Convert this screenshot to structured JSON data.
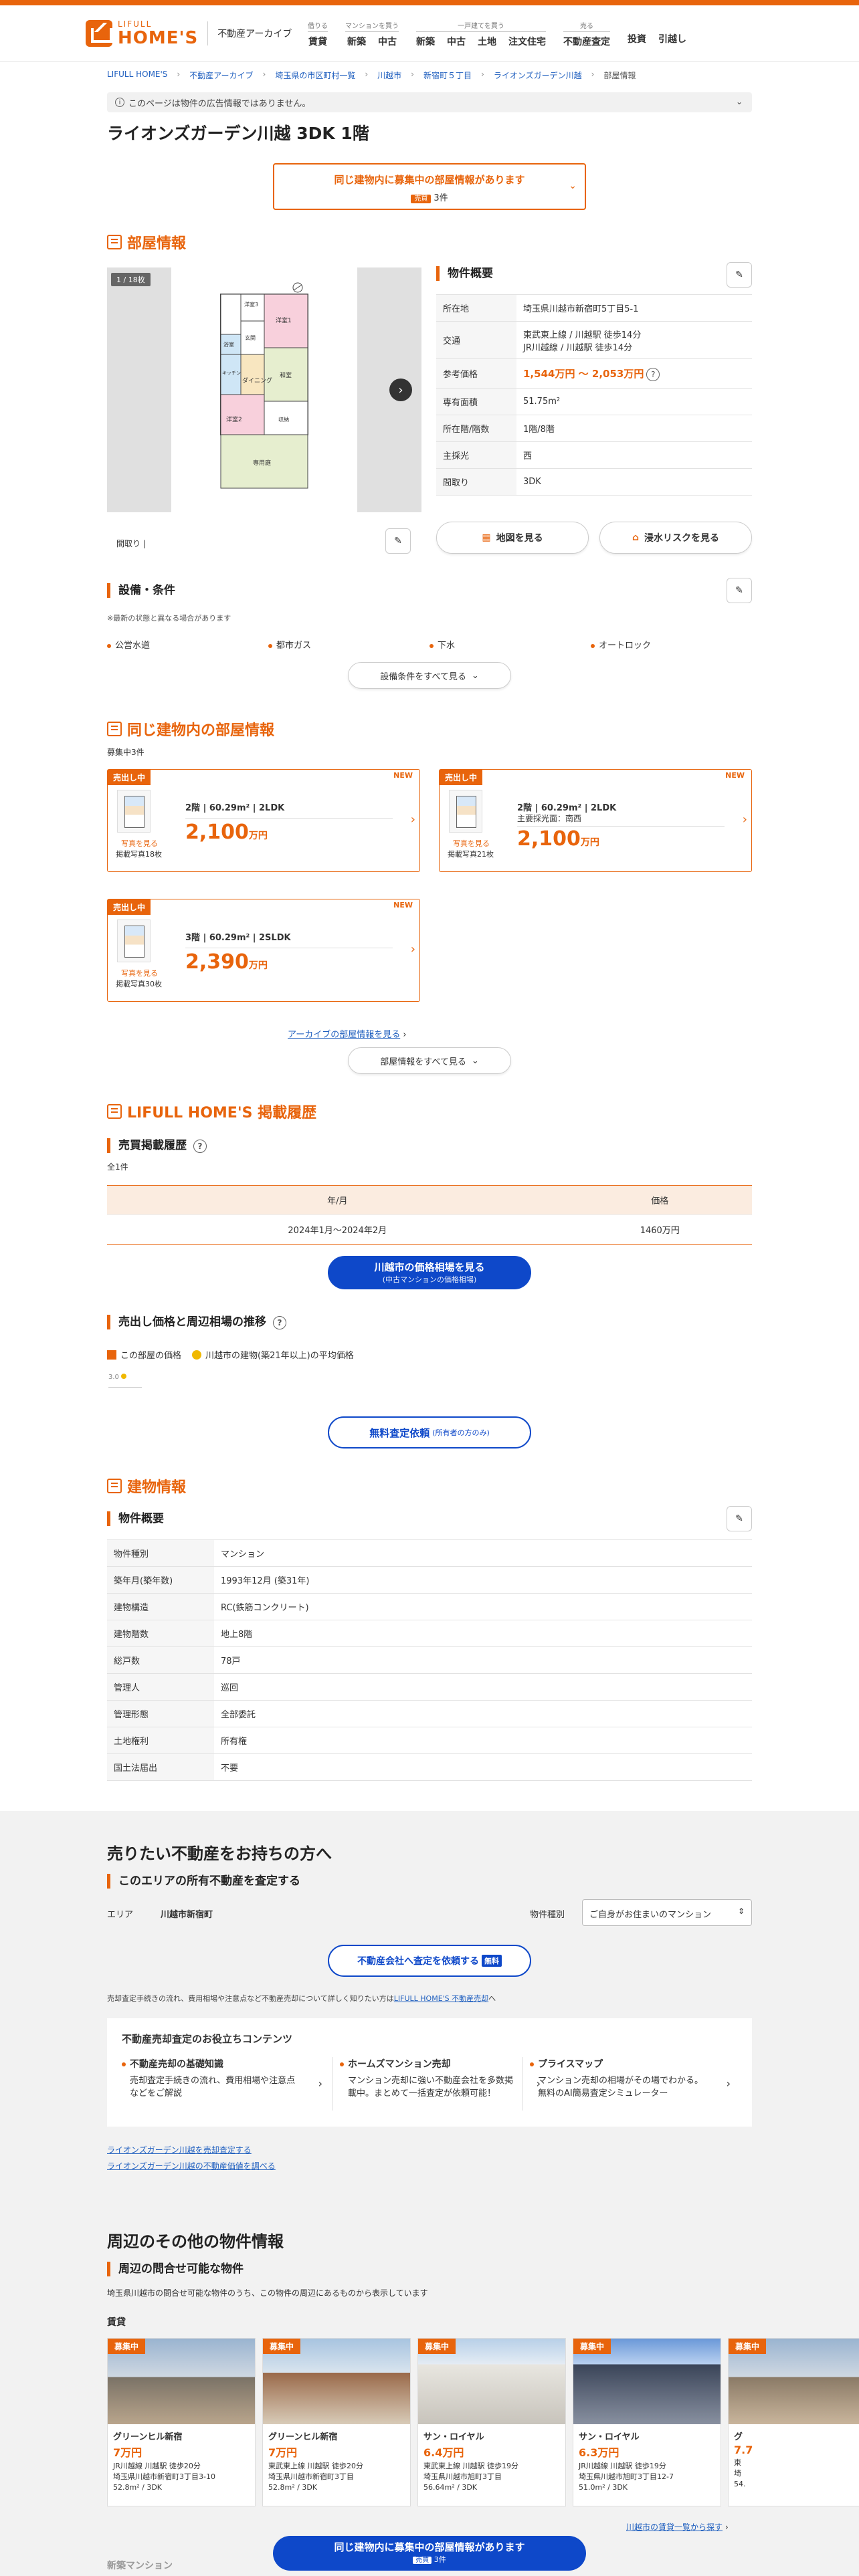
{
  "header": {
    "logo_small": "LIFULL",
    "logo_big": "HOME'S",
    "site_section": "不動産アーカイブ",
    "nav": [
      {
        "caption": "借りる",
        "links": [
          "賃貸"
        ]
      },
      {
        "caption": "マンションを買う",
        "links": [
          "新築",
          "中古"
        ]
      },
      {
        "caption": "一戸建てを買う",
        "links": [
          "新築",
          "中古",
          "土地",
          "注文住宅"
        ]
      },
      {
        "caption": "売る",
        "links": [
          "不動産査定"
        ]
      },
      {
        "caption": "",
        "links": [
          "投資",
          "引越し"
        ]
      }
    ]
  },
  "breadcrumb": [
    "LIFULL HOME'S",
    "不動産アーカイブ",
    "埼玉県の市区町村一覧",
    "川越市",
    "新宿町５丁目",
    "ライオンズガーデン川越",
    "部屋情報"
  ],
  "notice": "このページは物件の広告情報ではありません。",
  "title": "ライオンズガーデン川越 3DK 1階",
  "same_building_banner": {
    "text": "同じ建物内に募集中の部屋情報があります",
    "badge": "売買",
    "count": "3件"
  },
  "room_section": {
    "title": "部屋情報",
    "gallery_counter": "1 / 18枚",
    "floorplan_caption": "間取り",
    "floorplan_rooms": [
      "洋室1",
      "洋室2",
      "洋室3",
      "ダイニング",
      "和室",
      "キッチン",
      "浴室",
      "専用庭",
      "玄関",
      "収納"
    ],
    "overview_title": "物件概要",
    "overview": [
      {
        "k": "所在地",
        "v": "埼玉県川越市新宿町5丁目5-1"
      },
      {
        "k": "交通",
        "v": "東武東上線 / 川越駅 徒歩14分",
        "v2": "JR川越線 / 川越駅 徒歩14分"
      },
      {
        "k": "参考価格",
        "v": "1,544万円 〜 2,053万円"
      },
      {
        "k": "専有面積",
        "v": "51.75m²"
      },
      {
        "k": "所在階/階数",
        "v": "1階/8階"
      },
      {
        "k": "主採光",
        "v": "西"
      },
      {
        "k": "間取り",
        "v": "3DK"
      }
    ],
    "map_button": "地図を見る",
    "hazard_button": "浸水リスクを見る"
  },
  "equipment": {
    "title": "設備・条件",
    "note": "※最新の状態と異なる場合があります",
    "items": [
      "公営水道",
      "都市ガス",
      "下水",
      "オートロック"
    ],
    "more_button": "設備条件をすべて見る"
  },
  "same_building": {
    "title": "同じ建物内の部屋情報",
    "subtitle": "募集中3件",
    "cards": [
      {
        "tag": "売出し中",
        "new": "NEW",
        "info": "2階 | 60.29m² | 2LDK",
        "sub": "",
        "price": "2,100",
        "unit": "万円",
        "photo_link": "写真を見る",
        "photo_count": "掲載写真18枚"
      },
      {
        "tag": "売出し中",
        "new": "NEW",
        "info": "2階 | 60.29m² | 2LDK",
        "sub": "主要採光面：南西",
        "price": "2,100",
        "unit": "万円",
        "photo_link": "写真を見る",
        "photo_count": "掲載写真21枚"
      },
      {
        "tag": "売出し中",
        "new": "NEW",
        "info": "3階 | 60.29m² | 2SLDK",
        "sub": "",
        "price": "2,390",
        "unit": "万円",
        "photo_link": "写真を見る",
        "photo_count": "掲載写真30枚"
      }
    ],
    "archive_link": "アーカイブの部屋情報を見る",
    "more_button": "部屋情報をすべて見る"
  },
  "history": {
    "title": "LIFULL HOME'S 掲載履歴",
    "sale_title": "売買掲載履歴",
    "total": "全1件",
    "headers": [
      "年/月",
      "価格"
    ],
    "rows": [
      [
        "2024年1月〜2024年2月",
        "1460万円"
      ]
    ],
    "market_button": "川越市の価格相場を見る",
    "market_button_sub": "(中古マンションの価格相場)",
    "trend_title": "売出し価格と周辺相場の推移",
    "legend_room": "この部屋の価格",
    "legend_area": "川越市の建物(築21年以上)の平均価格",
    "chart_tick": "3.0",
    "assess_button": "無料査定依頼",
    "assess_button_sub": "(所有者の方のみ)"
  },
  "building": {
    "title": "建物情報",
    "overview_title": "物件概要",
    "rows": [
      {
        "k": "物件種別",
        "v": "マンション"
      },
      {
        "k": "築年月(築年数)",
        "v": "1993年12月 (築31年)"
      },
      {
        "k": "建物構造",
        "v": "RC(鉄筋コンクリート)"
      },
      {
        "k": "建物階数",
        "v": "地上8階"
      },
      {
        "k": "総戸数",
        "v": "78戸"
      },
      {
        "k": "管理人",
        "v": "巡回"
      },
      {
        "k": "管理形態",
        "v": "全部委託"
      },
      {
        "k": "土地権利",
        "v": "所有権"
      },
      {
        "k": "国土法届出",
        "v": "不要"
      }
    ]
  },
  "sell": {
    "title": "売りたい不動産をお持ちの方へ",
    "assess_title": "このエリアの所有不動産を査定する",
    "area_label": "エリア",
    "area_value": "川越市新宿町",
    "type_label": "物件種別",
    "type_value": "ご自身がお住まいのマンション",
    "request_button": "不動産会社へ査定を依頼する",
    "request_badge": "無料",
    "note_pre": "売却査定手続きの流れ、費用相場や注意点など不動産売却について詳しく知りたい方は",
    "note_link": "LIFULL HOME'S 不動産売却",
    "note_post": "へ",
    "contents_title": "不動産売却査定のお役立ちコンテンツ",
    "contents": [
      {
        "title": "不動産売却の基礎知識",
        "desc": "売却査定手続きの流れ、費用相場や注意点などをご解説"
      },
      {
        "title": "ホームズマンション売却",
        "desc": "マンション売却に強い不動産会社を多数掲載中。まとめて一括査定が依頼可能！"
      },
      {
        "title": "プライスマップ",
        "desc": "マンション売却の相場がその場でわかる。無料のAI簡易査定シミュレーター"
      }
    ],
    "links": [
      "ライオンズガーデン川越を売却査定する",
      "ライオンズガーデン川越の不動産価値を調べる"
    ]
  },
  "nearby": {
    "title": "周辺のその他の物件情報",
    "sub_title": "周辺の問合せ可能な物件",
    "desc": "埼玉県川越市の問合せ可能な物件のうち、この物件の周辺にあるものから表示しています",
    "category": "賃貸",
    "cards": [
      {
        "tag": "募集中",
        "name": "グリーンヒル新宿",
        "price": "7万円",
        "addr1": "JR川越線 川越駅 徒歩20分",
        "addr2": "埼玉県川越市新宿町3丁目3-10",
        "spec": "52.8m² / 3DK"
      },
      {
        "tag": "募集中",
        "name": "グリーンヒル新宿",
        "price": "7万円",
        "addr1": "東武東上線 川越駅 徒歩20分",
        "addr2": "埼玉県川越市新宿町3丁目",
        "spec": "52.8m² / 3DK"
      },
      {
        "tag": "募集中",
        "name": "サン・ロイヤル",
        "price": "6.4万円",
        "addr1": "東武東上線 川越駅 徒歩19分",
        "addr2": "埼玉県川越市旭町3丁目",
        "spec": "56.64m² / 3DK"
      },
      {
        "tag": "募集中",
        "name": "サン・ロイヤル",
        "price": "6.3万円",
        "addr1": "JR川越線 川越駅 徒歩19分",
        "addr2": "埼玉県川越市旭町3丁目12-7",
        "spec": "51.0m² / 3DK"
      },
      {
        "tag": "募集中",
        "name": "グ",
        "price": "7.7",
        "addr1": "東",
        "addr2": "埼",
        "spec": "54."
      }
    ],
    "more_link": "川越市の賃貸一覧から探す",
    "next_title": "新築マンション"
  },
  "bottom_bar": {
    "text": "同じ建物内に募集中の部屋情報があります",
    "badge": "売買",
    "count": "3件"
  }
}
